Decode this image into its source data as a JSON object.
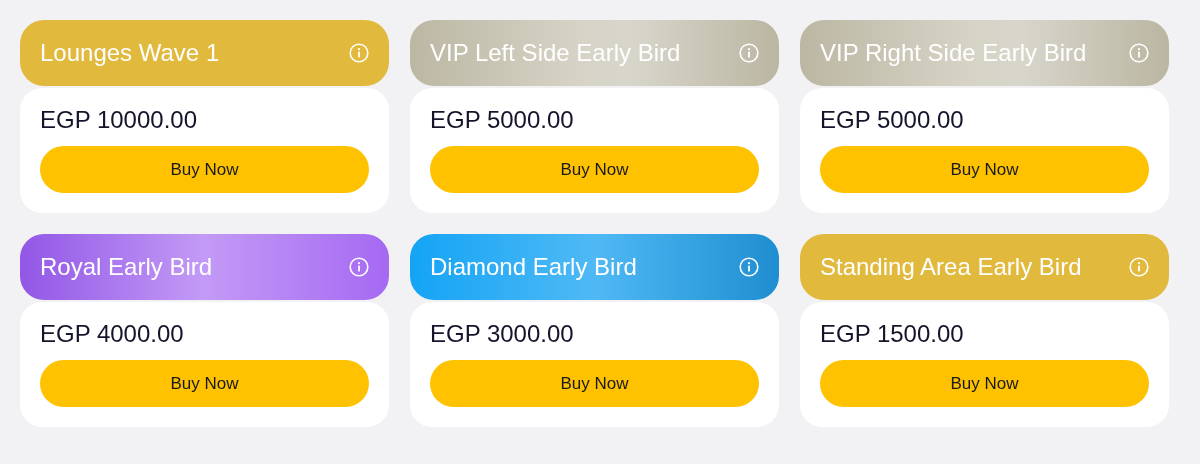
{
  "tickets": [
    {
      "name": "Lounges Wave 1",
      "kind": "gold",
      "price": "EGP 10000.00",
      "button": "Buy Now"
    },
    {
      "name": "VIP Left Side Early Bird",
      "kind": "silver",
      "price": "EGP 5000.00",
      "button": "Buy Now"
    },
    {
      "name": "VIP Right Side Early Bird",
      "kind": "silver",
      "price": "EGP 5000.00",
      "button": "Buy Now"
    },
    {
      "name": "Royal Early Bird",
      "kind": "royal",
      "price": "EGP 4000.00",
      "button": "Buy Now"
    },
    {
      "name": "Diamond Early Bird",
      "kind": "diamond",
      "price": "EGP 3000.00",
      "button": "Buy Now"
    },
    {
      "name": "Standing Area Early Bird",
      "kind": "gold",
      "price": "EGP 1500.00",
      "button": "Buy Now"
    }
  ]
}
